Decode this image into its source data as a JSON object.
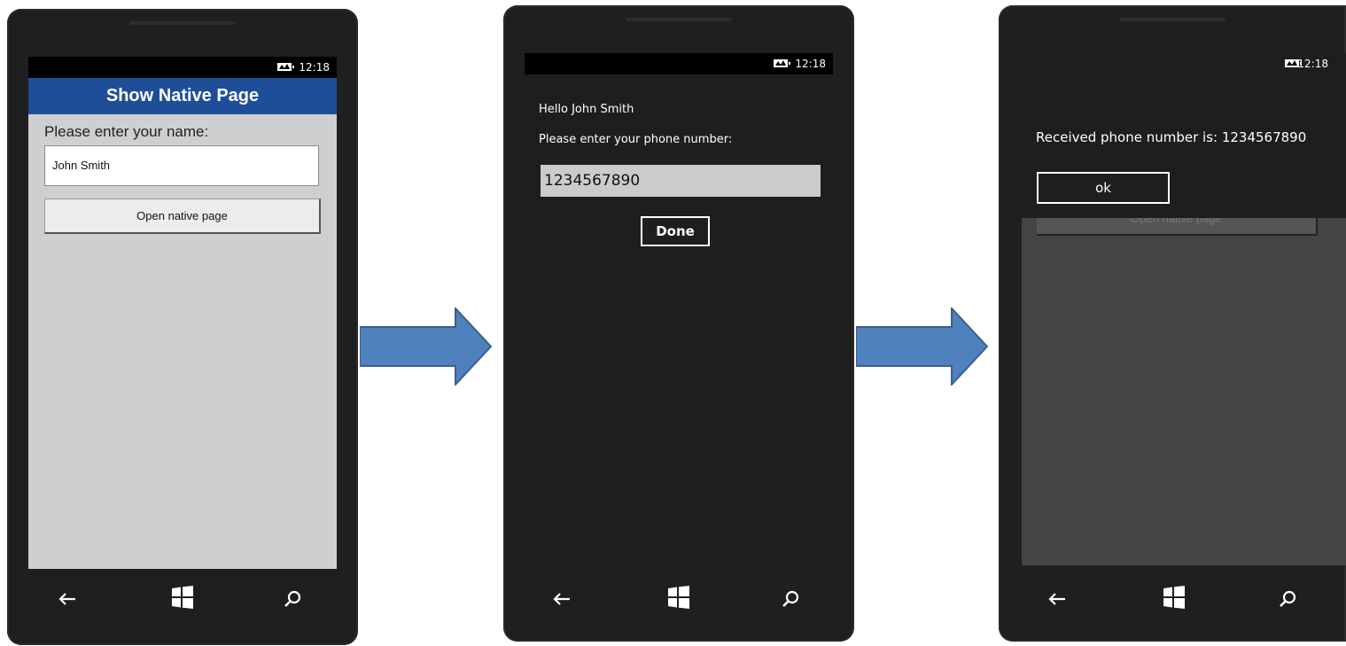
{
  "status": {
    "time": "12:18"
  },
  "screen1": {
    "title": "Show Native Page",
    "name_label": "Please enter your name:",
    "name_value": "John Smith",
    "open_button": "Open native page"
  },
  "screen2": {
    "greeting": "Hello John Smith",
    "phone_prompt": "Please enter your phone number:",
    "phone_value": "1234567890",
    "done_button": "Done"
  },
  "screen3": {
    "received_text": "Received phone number is: 1234567890",
    "ok_button": "ok",
    "background_button": "Open native page"
  },
  "colors": {
    "header_blue": "#1f4e99",
    "arrow_blue": "#4f81bd",
    "arrow_border": "#3a5f8c"
  },
  "icons": [
    "back-arrow-icon",
    "windows-logo-icon",
    "search-icon",
    "signal-battery-icon"
  ]
}
